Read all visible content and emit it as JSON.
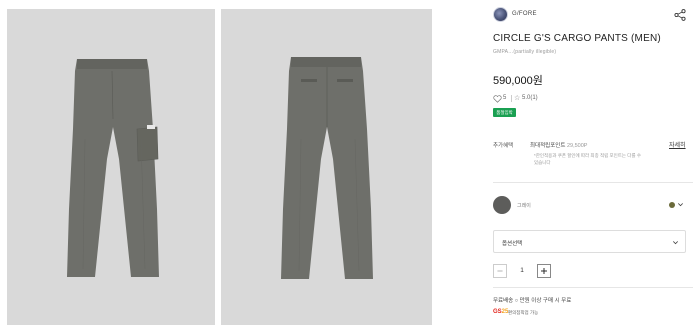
{
  "product": {
    "brand": "G/FORE",
    "title": "CIRCLE G'S CARGO PANTS (MEN)",
    "sku": "GMPA…(partially illegible)",
    "price": "590,000원",
    "likes": "5",
    "rating": "5.0(1)",
    "badge": "품절임박"
  },
  "benefits": {
    "label": "추가혜택",
    "points_label": "최대적립포인트",
    "points_value": "29,500P",
    "detail_link": "자세히",
    "note": "*한인적용과 쿠폰 할인에 따라 최종 적립 포인트는 다를 수 있습니다"
  },
  "color": {
    "name": "그레이",
    "swatch": "#5d5d5b",
    "dot": "#6b6a3a"
  },
  "option_select": {
    "placeholder": "옵션선택"
  },
  "quantity": {
    "value": "1"
  },
  "shipping": {
    "text": "무료배송 ○ 만원 이상 구매 시 무료"
  },
  "partner": {
    "logo_main": "GS",
    "logo_sup": "25",
    "text": "편의점픽업 가능"
  },
  "icons": {
    "share": "share-icon",
    "heart": "heart-icon",
    "star": "star-icon",
    "chevron": "chevron-down-icon",
    "minus": "minus-icon",
    "plus": "plus-icon"
  },
  "colors": {
    "badge_green": "#1aa052",
    "pants_gray": "#6e6f6a",
    "photo_bg": "#d9d9d9"
  }
}
